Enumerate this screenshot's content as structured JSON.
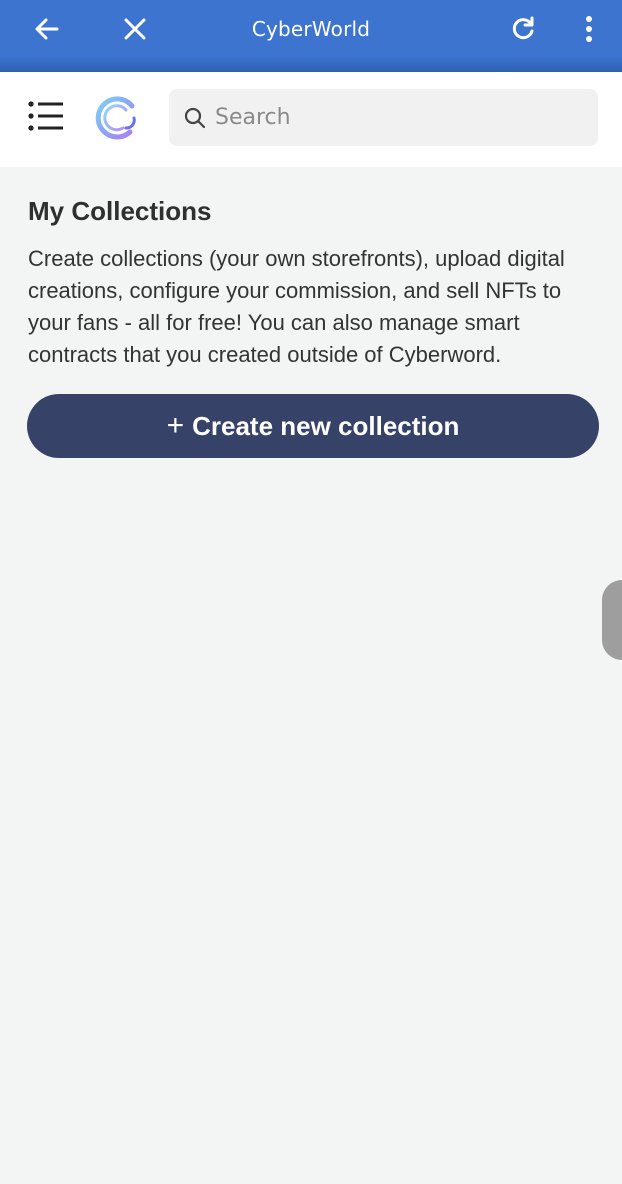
{
  "topbar": {
    "title": "CyberWorld",
    "background": "#3d74cf",
    "back_icon": "arrow-left-icon",
    "close_icon": "close-icon",
    "refresh_icon": "refresh-icon",
    "more_icon": "more-vertical-icon"
  },
  "header": {
    "menu_icon": "list-menu-icon",
    "logo": "cyberworld-logo",
    "search": {
      "placeholder": "Search",
      "value": ""
    }
  },
  "main": {
    "title": "My Collections",
    "description": "Create collections (your own storefronts), upload digital creations, configure your commission, and sell NFTs to your fans - all for free! You can also manage smart contracts that you created outside of Cyberword.",
    "create_button": {
      "icon": "+",
      "label": "Create new collection",
      "color": "#364268"
    }
  }
}
